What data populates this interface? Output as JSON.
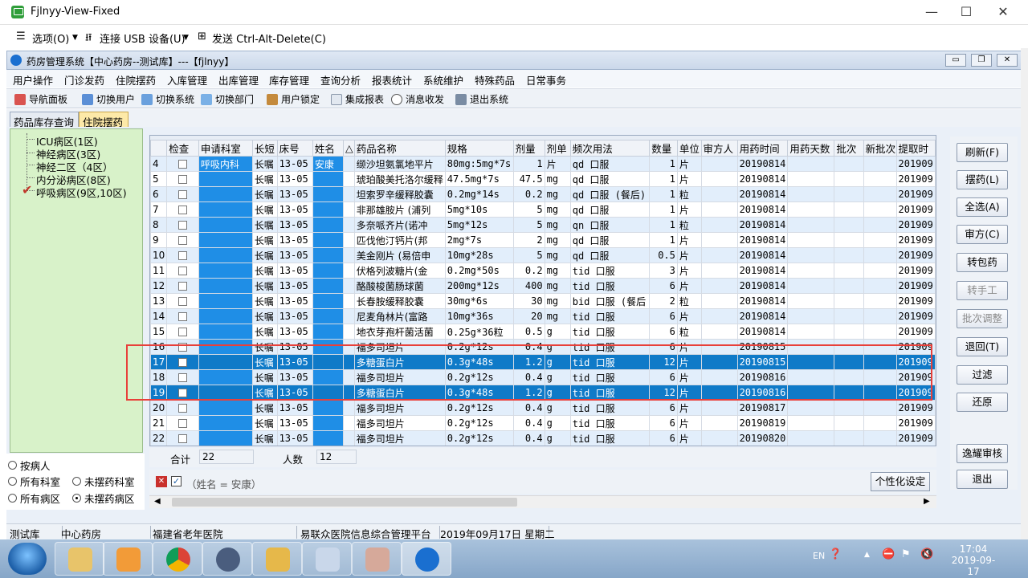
{
  "viewer": {
    "title": "Fjlnyy-View-Fixed",
    "menu": [
      "选项(O)",
      "连接 USB 设备(U)",
      "发送 Ctrl-Alt-Delete(C)"
    ],
    "controls": {
      "minimize": "—",
      "maximize": "☐",
      "close": "✕"
    }
  },
  "app": {
    "title": "药房管理系统【中心药房--测试库】---【fjlnyy】",
    "menus": [
      "用户操作",
      "门诊发药",
      "住院摆药",
      "入库管理",
      "出库管理",
      "库存管理",
      "查询分析",
      "报表统计",
      "系统维护",
      "特殊药品",
      "日常事务"
    ],
    "toolbar": [
      "导航面板",
      "切换用户",
      "切换系统",
      "切换部门",
      "用户锁定",
      "集成报表",
      "消息收发",
      "退出系统"
    ],
    "tabs": [
      "药品库存查询",
      "住院摆药"
    ]
  },
  "tree": {
    "items": [
      {
        "label": "ICU病区(1区)",
        "checked": false
      },
      {
        "label": "神经病区(3区)",
        "checked": false
      },
      {
        "label": "神经二区（4区）",
        "checked": false
      },
      {
        "label": "内分泌病区(8区)",
        "checked": false
      },
      {
        "label": "呼吸病区(9区,10区)",
        "checked": true
      }
    ]
  },
  "filters": {
    "by_patient": "按病人",
    "all_depts": "所有科室",
    "undispensed_depts": "未摆药科室",
    "all_wards": "所有病区",
    "undispensed_wards": "未摆药病区"
  },
  "grid": {
    "columns": [
      "",
      "检查",
      "申请科室",
      "长短",
      "床号",
      "姓名",
      "△",
      "药品名称",
      "规格",
      "剂量",
      "剂单",
      "频次用法",
      "数量",
      "单位",
      "审方人",
      "用药时间",
      "用药天数",
      "批次",
      "新批次",
      "提取时"
    ],
    "dept": "呼吸内科",
    "patient": "安康",
    "rows": [
      {
        "no": "4",
        "type": "长嘱",
        "bed": "13-05",
        "drug": "缬沙坦氨氯地平片",
        "spec": "80mg:5mg*7s",
        "dose": "1",
        "unit": "片",
        "freq": "qd 口服",
        "qty": "1",
        "qunit": "片",
        "date": "20190814",
        "ext": "201909"
      },
      {
        "no": "5",
        "type": "长嘱",
        "bed": "13-05",
        "drug": "琥珀酸美托洛尔缓释",
        "spec": "47.5mg*7s",
        "dose": "47.5",
        "unit": "mg",
        "freq": "qd 口服",
        "qty": "1",
        "qunit": "片",
        "date": "20190814",
        "ext": "201909"
      },
      {
        "no": "6",
        "type": "长嘱",
        "bed": "13-05",
        "drug": "坦索罗辛缓释胶囊",
        "spec": "0.2mg*14s",
        "dose": "0.2",
        "unit": "mg",
        "freq": "qd 口服 (餐后)",
        "qty": "1",
        "qunit": "粒",
        "date": "20190814",
        "ext": "201909"
      },
      {
        "no": "7",
        "type": "长嘱",
        "bed": "13-05",
        "drug": "非那雄胺片 (浦列",
        "spec": "5mg*10s",
        "dose": "5",
        "unit": "mg",
        "freq": "qd 口服",
        "qty": "1",
        "qunit": "片",
        "date": "20190814",
        "ext": "201909"
      },
      {
        "no": "8",
        "type": "长嘱",
        "bed": "13-05",
        "drug": "多奈哌齐片(诺冲",
        "spec": "5mg*12s",
        "dose": "5",
        "unit": "mg",
        "freq": "qn 口服",
        "qty": "1",
        "qunit": "粒",
        "date": "20190814",
        "ext": "201909"
      },
      {
        "no": "9",
        "type": "长嘱",
        "bed": "13-05",
        "drug": "匹伐他汀钙片(邦",
        "spec": "2mg*7s",
        "dose": "2",
        "unit": "mg",
        "freq": "qd 口服",
        "qty": "1",
        "qunit": "片",
        "date": "20190814",
        "ext": "201909"
      },
      {
        "no": "10",
        "type": "长嘱",
        "bed": "13-05",
        "drug": "美金刚片 (易倍申",
        "spec": "10mg*28s",
        "dose": "5",
        "unit": "mg",
        "freq": "qd 口服",
        "qty": "0.5",
        "qunit": "片",
        "date": "20190814",
        "ext": "201909"
      },
      {
        "no": "11",
        "type": "长嘱",
        "bed": "13-05",
        "drug": "伏格列波糖片(金",
        "spec": "0.2mg*50s",
        "dose": "0.2",
        "unit": "mg",
        "freq": "tid 口服",
        "qty": "3",
        "qunit": "片",
        "date": "20190814",
        "ext": "201909"
      },
      {
        "no": "12",
        "type": "长嘱",
        "bed": "13-05",
        "drug": "酪酸梭菌肠球菌",
        "spec": "200mg*12s",
        "dose": "400",
        "unit": "mg",
        "freq": "tid 口服",
        "qty": "6",
        "qunit": "片",
        "date": "20190814",
        "ext": "201909"
      },
      {
        "no": "13",
        "type": "长嘱",
        "bed": "13-05",
        "drug": "长春胺缓释胶囊",
        "spec": "30mg*6s",
        "dose": "30",
        "unit": "mg",
        "freq": "bid 口服 (餐后",
        "qty": "2",
        "qunit": "粒",
        "date": "20190814",
        "ext": "201909"
      },
      {
        "no": "14",
        "type": "长嘱",
        "bed": "13-05",
        "drug": "尼麦角林片(富路",
        "spec": "10mg*36s",
        "dose": "20",
        "unit": "mg",
        "freq": "tid 口服",
        "qty": "6",
        "qunit": "片",
        "date": "20190814",
        "ext": "201909"
      },
      {
        "no": "15",
        "type": "长嘱",
        "bed": "13-05",
        "drug": "地衣芽孢杆菌活菌",
        "spec": "0.25g*36粒",
        "dose": "0.5",
        "unit": "g",
        "freq": "tid 口服",
        "qty": "6",
        "qunit": "粒",
        "date": "20190814",
        "ext": "201909"
      },
      {
        "no": "16",
        "type": "长嘱",
        "bed": "13-05",
        "drug": "福多司坦片",
        "spec": "0.2g*12s",
        "dose": "0.4",
        "unit": "g",
        "freq": "tid 口服",
        "qty": "6",
        "qunit": "片",
        "date": "20190815",
        "ext": "201909"
      },
      {
        "no": "17",
        "type": "长嘱",
        "bed": "13-05",
        "drug": "多糖蛋白片",
        "spec": "0.3g*48s",
        "dose": "1.2",
        "unit": "g",
        "freq": "tid 口服",
        "qty": "12",
        "qunit": "片",
        "date": "20190815",
        "ext": "201909",
        "sel": true
      },
      {
        "no": "18",
        "type": "长嘱",
        "bed": "13-05",
        "drug": "福多司坦片",
        "spec": "0.2g*12s",
        "dose": "0.4",
        "unit": "g",
        "freq": "tid 口服",
        "qty": "6",
        "qunit": "片",
        "date": "20190816",
        "ext": "201909"
      },
      {
        "no": "19",
        "type": "长嘱",
        "bed": "13-05",
        "drug": "多糖蛋白片",
        "spec": "0.3g*48s",
        "dose": "1.2",
        "unit": "g",
        "freq": "tid 口服",
        "qty": "12",
        "qunit": "片",
        "date": "20190816",
        "ext": "201909",
        "sel": true
      },
      {
        "no": "20",
        "type": "长嘱",
        "bed": "13-05",
        "drug": "福多司坦片",
        "spec": "0.2g*12s",
        "dose": "0.4",
        "unit": "g",
        "freq": "tid 口服",
        "qty": "6",
        "qunit": "片",
        "date": "20190817",
        "ext": "201909"
      },
      {
        "no": "21",
        "type": "长嘱",
        "bed": "13-05",
        "drug": "福多司坦片",
        "spec": "0.2g*12s",
        "dose": "0.4",
        "unit": "g",
        "freq": "tid 口服",
        "qty": "6",
        "qunit": "片",
        "date": "20190819",
        "ext": "201909"
      },
      {
        "no": "22",
        "type": "长嘱",
        "bed": "13-05",
        "drug": "福多司坦片",
        "spec": "0.2g*12s",
        "dose": "0.4",
        "unit": "g",
        "freq": "tid 口服",
        "qty": "6",
        "qunit": "片",
        "date": "20190820",
        "ext": "201909"
      }
    ]
  },
  "totals": {
    "sum_label": "合计",
    "sum_value": "22",
    "count_label": "人数",
    "count_value": "12"
  },
  "filter_text": "（姓名 = 安康）",
  "custom_settings": "个性化设定",
  "buttons": [
    "刷新(F)",
    "摆药(L)",
    "全选(A)",
    "审方(C)",
    "转包药",
    "转手工",
    "批次调整",
    "退回(T)",
    "过滤",
    "还原",
    "逸耀审核",
    "退出"
  ],
  "disabled_buttons": [
    "转手工",
    "批次调整"
  ],
  "status": [
    "测试库",
    "中心药房",
    "福建省老年医院",
    "易联众医院信息综合管理平台",
    "2019年09月17日 星期二"
  ],
  "taskbar": {
    "time": "17:04",
    "date": "2019-09-17",
    "lang": "EN"
  },
  "colors": {
    "selection": "#0f7ac8",
    "dept_cell": "#1f8ee6",
    "row_alt": "#e2eefb",
    "tree_bg": "#d8f2c9",
    "highlight_box": "#e8403a"
  }
}
